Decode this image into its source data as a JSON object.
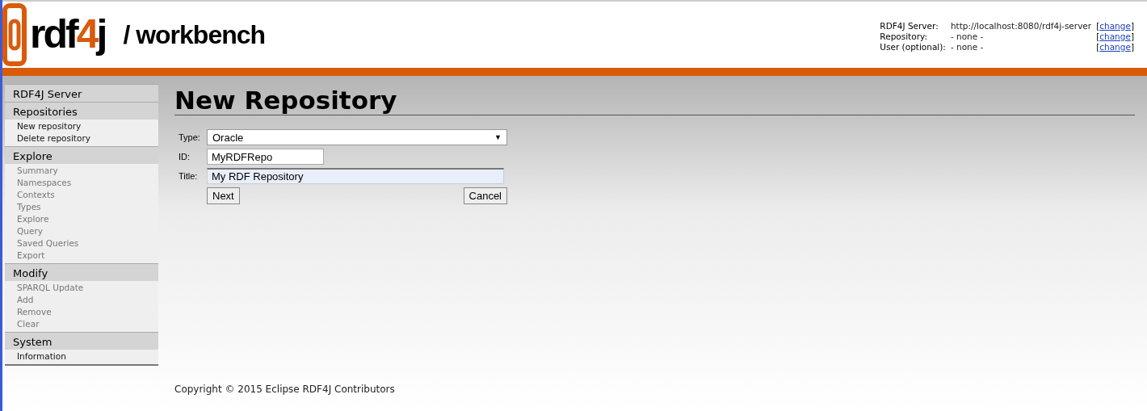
{
  "header": {
    "logo": {
      "name": "rdf",
      "accent": "4",
      "suffix": "j"
    },
    "subtitle": "/ workbench",
    "info": [
      {
        "label": "RDF4J Server:",
        "value": "http://localhost:8080/rdf4j-server",
        "open": "[",
        "link": "change",
        "close": "]"
      },
      {
        "label": "Repository:",
        "value": "- none -",
        "open": "[",
        "link": "change",
        "close": "]"
      },
      {
        "label": "User (optional):",
        "value": "- none -",
        "open": "[",
        "link": "change",
        "close": "]"
      }
    ]
  },
  "sidebar": [
    {
      "title": "RDF4J Server"
    },
    {
      "title": "Repositories",
      "items": [
        {
          "label": "New repository",
          "disabled": false
        },
        {
          "label": "Delete repository",
          "disabled": false
        }
      ]
    },
    {
      "title": "Explore",
      "items": [
        {
          "label": "Summary",
          "disabled": true
        },
        {
          "label": "Namespaces",
          "disabled": true
        },
        {
          "label": "Contexts",
          "disabled": true
        },
        {
          "label": "Types",
          "disabled": true
        },
        {
          "label": "Explore",
          "disabled": true
        },
        {
          "label": "Query",
          "disabled": true
        },
        {
          "label": "Saved Queries",
          "disabled": true
        },
        {
          "label": "Export",
          "disabled": true
        }
      ]
    },
    {
      "title": "Modify",
      "items": [
        {
          "label": "SPARQL Update",
          "disabled": true
        },
        {
          "label": "Add",
          "disabled": true
        },
        {
          "label": "Remove",
          "disabled": true
        },
        {
          "label": "Clear",
          "disabled": true
        }
      ]
    },
    {
      "title": "System",
      "items": [
        {
          "label": "Information",
          "disabled": false
        }
      ]
    }
  ],
  "page_title": "New Repository",
  "form": {
    "fields": [
      {
        "kind": "select",
        "label": "Type:",
        "value": "Oracle",
        "arrow": "▼"
      },
      {
        "kind": "text",
        "label": "ID:",
        "value": "MyRDFRepo",
        "focused": false
      },
      {
        "kind": "text",
        "label": "Title:",
        "value": "My RDF Repository",
        "focused": true
      }
    ],
    "buttons": [
      "Next",
      "Cancel"
    ]
  },
  "footer": "Copyright © 2015 Eclipse RDF4J Contributors"
}
